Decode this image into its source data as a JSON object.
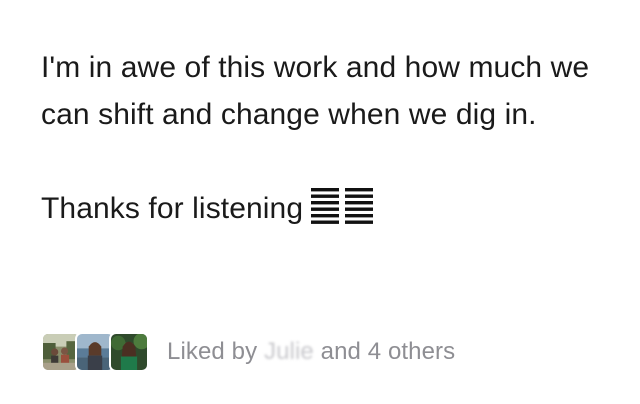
{
  "post": {
    "paragraph_1": "I'm in awe of this work and how much we can shift and change when we dig in.",
    "paragraph_2_text": "Thanks for listening",
    "paragraph_2_emoji": "hexagram-icon"
  },
  "likes": {
    "prefix": "Liked by",
    "name": "Julie",
    "suffix": "and 4 others",
    "avatars": [
      "avatar-outdoor-group",
      "avatar-lake-portrait",
      "avatar-forest-portrait"
    ]
  },
  "colors": {
    "text": "#1a1a1a",
    "muted": "#8e8e93",
    "background": "#ffffff"
  }
}
